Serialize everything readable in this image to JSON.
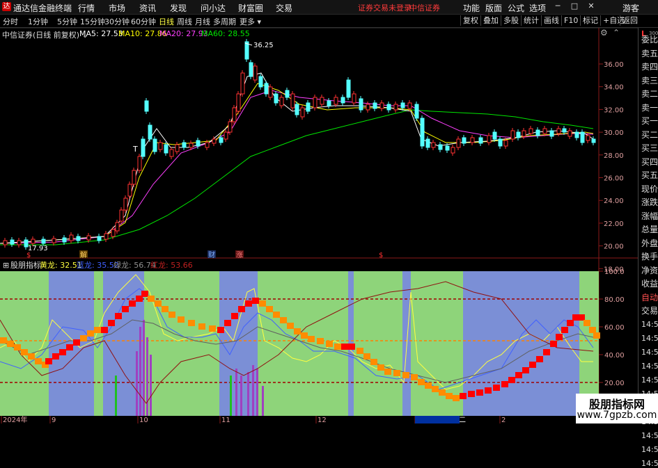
{
  "topbar": {
    "logo": "达",
    "app_title": "通达信金融终端",
    "menus": [
      "行情",
      "市场",
      "资讯",
      "发现",
      "问小达",
      "财富圈",
      "交易"
    ],
    "warning": "证券交易未登录",
    "broker": "中信证券",
    "right_menus": [
      "功能",
      "版面",
      "公式",
      "选项"
    ],
    "guest": "游客"
  },
  "tabs": {
    "periods": [
      "分时",
      "1分钟",
      "5分钟",
      "15分钟",
      "30分钟",
      "60分钟",
      "日线",
      "周线",
      "月线",
      "多周期",
      "更多"
    ],
    "active": "日线",
    "right_buttons": [
      "复权",
      "叠加",
      "多股",
      "统计",
      "画线",
      "F10",
      "标记",
      "+自选",
      "返回"
    ]
  },
  "stock": {
    "name_line": "中信证券(日线 前复权)",
    "ma5": "MA5: 27.53",
    "ma10": "MA10: 27.86",
    "ma20": "MA20: 27.93",
    "ma60": "MA60: 28.55",
    "high_label": "36.25",
    "low_label": "17.93",
    "t_marker": "T",
    "event_labels": [
      "解",
      "财",
      "涨",
      "$",
      "$"
    ]
  },
  "price_axis": [
    "36.00",
    "34.00",
    "32.00",
    "30.00",
    "28.00",
    "26.00",
    "24.00",
    "22.00",
    "20.00",
    "18.00"
  ],
  "indicator": {
    "name": "股朋指标",
    "huanglong": "黄龙: 32.51",
    "lanlong": "蓝龙: 35.52",
    "lvlong": "绿龙: 56.74",
    "honglong": "红龙: 53.66",
    "axis": [
      "100.0",
      "80.00",
      "60.00",
      "40.00",
      "20.00"
    ]
  },
  "date_axis": [
    "2024年",
    "9",
    "10",
    "11",
    "12",
    "2024/12/31/二",
    "2"
  ],
  "side_panel": {
    "top_mark": "L",
    "top_sub": "300",
    "items": [
      "委比",
      "卖五",
      "卖四",
      "卖三",
      "卖二",
      "卖一",
      "买一",
      "买二",
      "买三",
      "买四",
      "买五",
      "现价",
      "涨跌",
      "涨幅",
      "总量",
      "外盘",
      "换手",
      "净资",
      "收益",
      "自动",
      "交易"
    ],
    "times": [
      "14:56",
      "14:56",
      "14:56",
      "14:56",
      "14:56",
      "14:56",
      "14:56",
      "14:56",
      "14:56",
      "14:56",
      "14:56"
    ]
  },
  "watermark": {
    "line1": "股朋指标网",
    "line2": "www.7gpzb.com"
  },
  "colors": {
    "up": "#ff3232",
    "down": "#54ffff",
    "ma5": "#ffffff",
    "ma10": "#ffff00",
    "ma20": "#ff00ff",
    "ma60": "#00e600",
    "green_zone": "#8ed47a",
    "blue_zone": "#7b8fd6",
    "orange": "#ff8c00",
    "red_step": "#ff0000"
  }
}
